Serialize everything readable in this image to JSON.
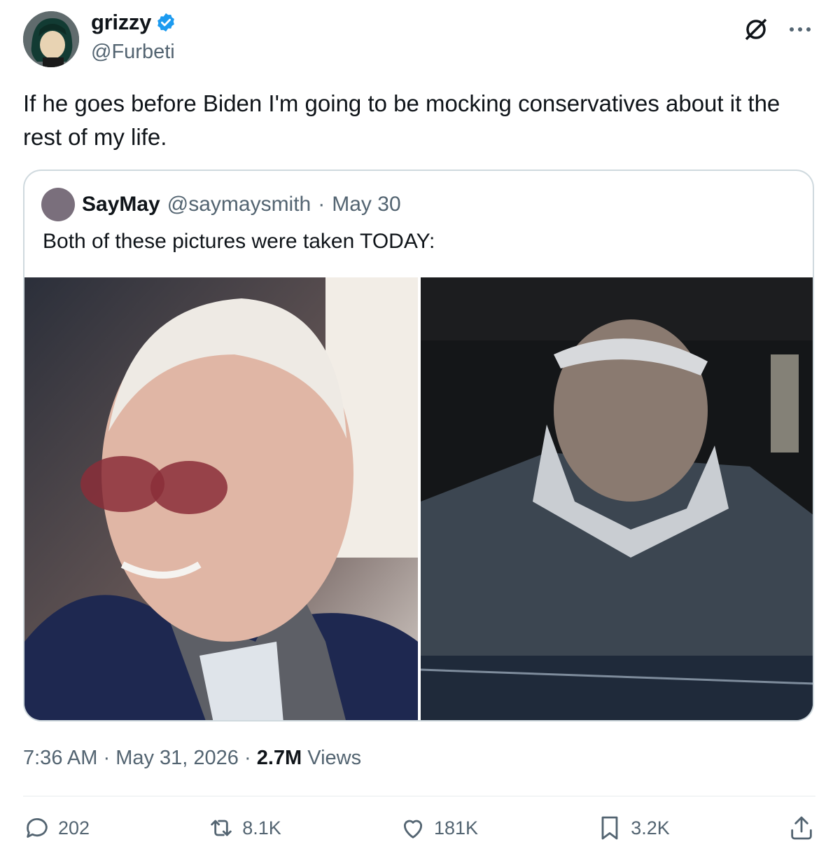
{
  "author": {
    "name": "grizzy",
    "handle": "@Furbeti",
    "verified": true,
    "verified_color": "#1d9bf0"
  },
  "icons": {
    "top": [
      "grok-icon",
      "more-icon"
    ]
  },
  "tweet": {
    "text": "If he goes before Biden I'm going to be mocking conservatives about it the rest of my life."
  },
  "quote": {
    "name": "SayMay",
    "handle": "@saymaysmith",
    "separator": "·",
    "date": "May 30",
    "text": "Both of these pictures were taken TODAY:"
  },
  "meta": {
    "time": "7:36 AM",
    "separator": "·",
    "date": "May 31, 2026",
    "views_count": "2.7M",
    "views_label": "Views"
  },
  "actions": {
    "replies": "202",
    "reposts": "8.1K",
    "likes": "181K",
    "bookmarks": "3.2K"
  }
}
